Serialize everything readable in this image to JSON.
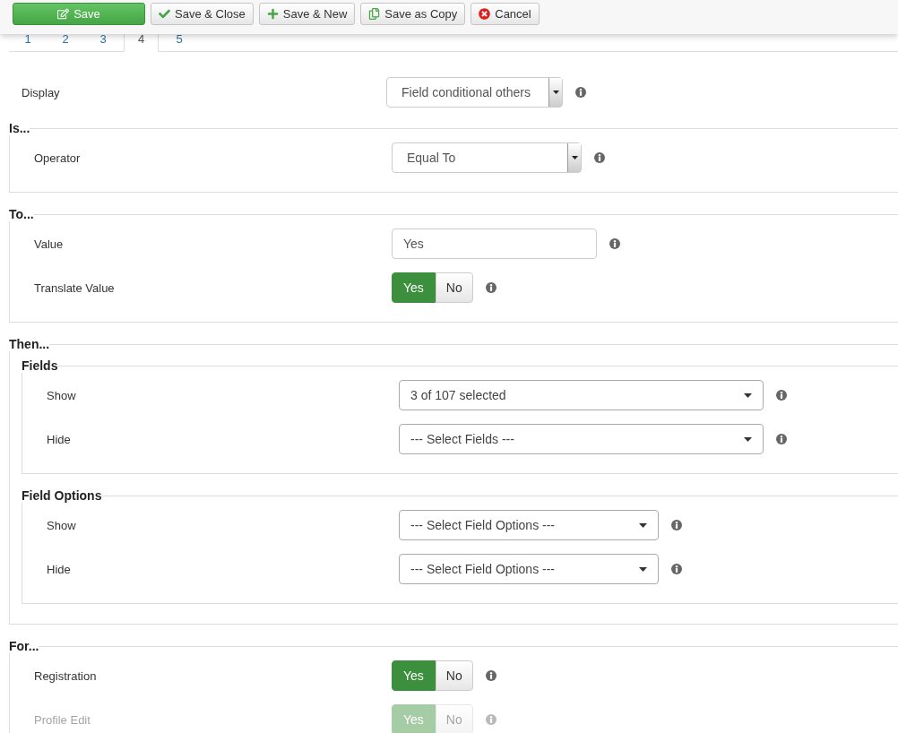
{
  "toolbar": {
    "buttons": [
      {
        "label": "Save",
        "kind": "primary"
      },
      {
        "label": "Save & Close",
        "kind": "default"
      },
      {
        "label": "Save & New",
        "kind": "default"
      },
      {
        "label": "Save as Copy",
        "kind": "default"
      },
      {
        "label": "Cancel",
        "kind": "default"
      }
    ]
  },
  "tabs": [
    {
      "label": "1",
      "selected": false
    },
    {
      "label": "2",
      "selected": false
    },
    {
      "label": "3",
      "selected": false
    },
    {
      "label": "4",
      "selected": true
    },
    {
      "label": "5",
      "selected": false
    }
  ],
  "display": {
    "label": "Display",
    "kind": "select",
    "value": "Field conditional others"
  },
  "sections": [
    {
      "legend": "Is...",
      "rows": [
        {
          "kind": "select",
          "label": "Operator",
          "value": "Equal To"
        }
      ]
    },
    {
      "legend": "To...",
      "rows": [
        {
          "kind": "text",
          "label": "Value",
          "value": "Yes"
        },
        {
          "kind": "toggle",
          "label": "Translate Value",
          "disabled": false,
          "options": [
            {
              "label": "Yes",
              "selected": true
            },
            {
              "label": "No",
              "selected": false
            }
          ]
        }
      ]
    },
    {
      "legend": "Then...",
      "groups": [
        {
          "legend": "Fields",
          "rows": [
            {
              "kind": "chosen",
              "label": "Show",
              "value": "3 of 107 selected"
            },
            {
              "kind": "chosen",
              "label": "Hide",
              "value": "--- Select Fields ---"
            }
          ]
        },
        {
          "legend": "Field Options",
          "rows": [
            {
              "kind": "chosen",
              "label": "Show",
              "value": "--- Select Field Options ---"
            },
            {
              "kind": "chosen",
              "label": "Hide",
              "value": "--- Select Field Options ---"
            }
          ]
        }
      ]
    },
    {
      "legend": "For...",
      "rows": [
        {
          "kind": "toggle",
          "label": "Registration",
          "disabled": false,
          "options": [
            {
              "label": "Yes",
              "selected": true
            },
            {
              "label": "No",
              "selected": false
            }
          ]
        },
        {
          "kind": "toggle",
          "label": "Profile Edit",
          "disabled": true,
          "options": [
            {
              "label": "Yes",
              "selected": true
            },
            {
              "label": "No",
              "selected": false
            }
          ]
        }
      ]
    }
  ]
}
